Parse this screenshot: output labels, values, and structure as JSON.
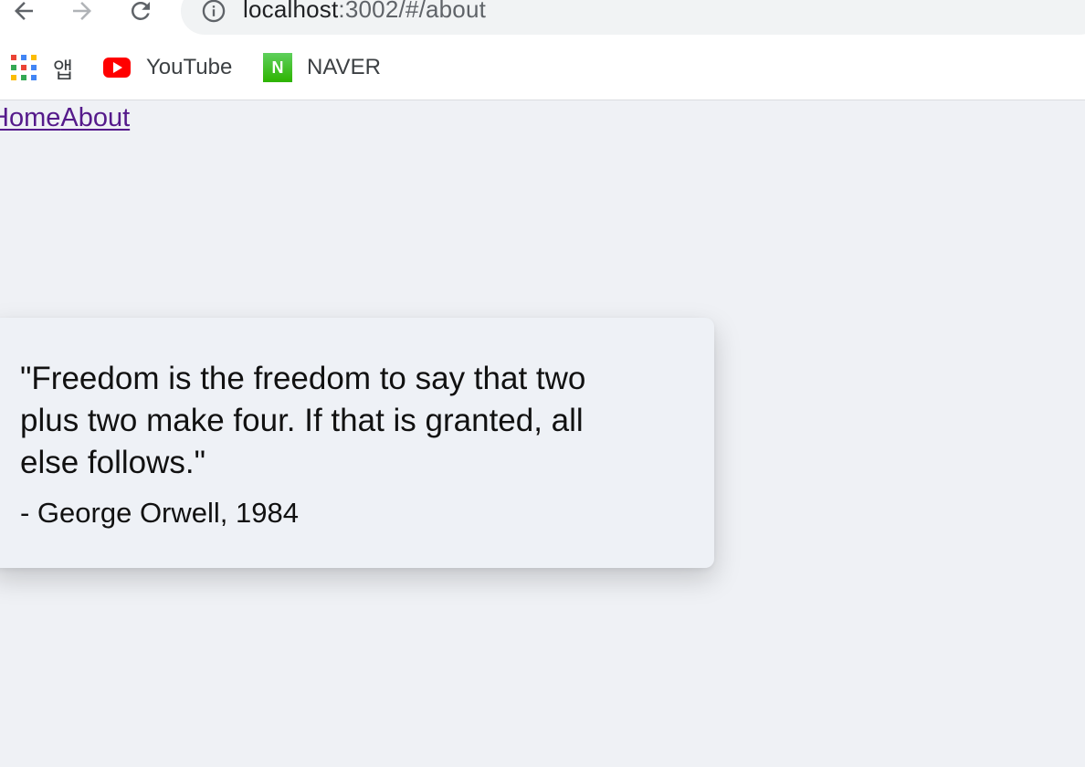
{
  "browser": {
    "url_host": "localhost",
    "url_path": ":3002/#/about",
    "bookmarks": [
      {
        "label": "앱",
        "icon": "apps-grid-icon"
      },
      {
        "label": "YouTube",
        "icon": "youtube-icon"
      },
      {
        "label": "NAVER",
        "icon": "naver-icon",
        "icon_text": "N"
      }
    ],
    "colors": {
      "apps": [
        "#ea4335",
        "#4285f4",
        "#fbbc05",
        "#34a853",
        "#ea4335",
        "#4285f4",
        "#fbbc05",
        "#34a853",
        "#4285f4"
      ],
      "youtube": "#ff0000",
      "naver": "#2db400"
    }
  },
  "nav": {
    "home_label": "Home",
    "about_label": "About"
  },
  "quote": {
    "text": "\"Freedom is the freedom to say that two plus two make four. If that is granted, all else follows.\"",
    "author": "- George Orwell, 1984"
  },
  "colors": {
    "page_background": "#eff1f5",
    "link": "#551a8b"
  }
}
